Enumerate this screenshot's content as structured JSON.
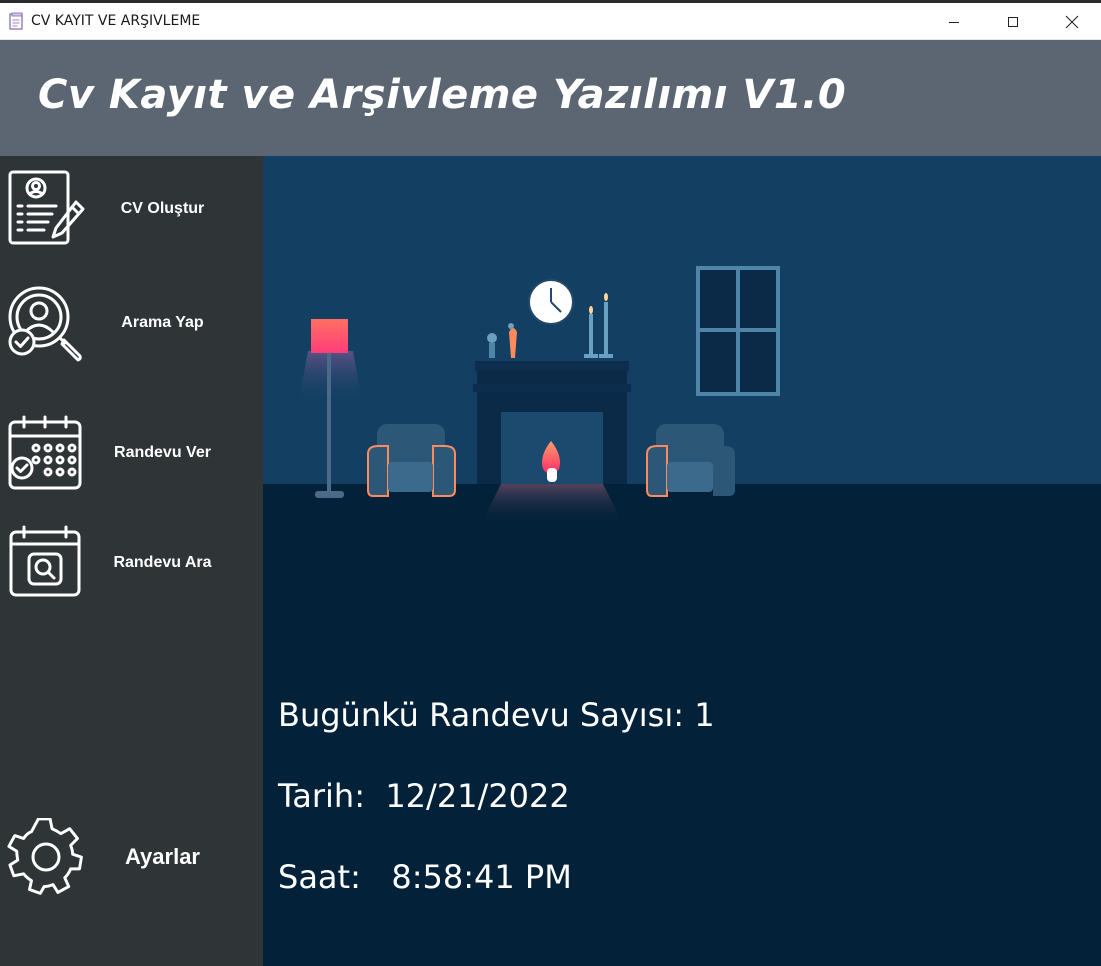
{
  "window": {
    "title": "CV KAYIT VE ARŞIVLEME",
    "controls": [
      "minimize-icon",
      "maximize-icon",
      "close-icon"
    ]
  },
  "header": {
    "title": "Cv Kayıt ve Arşivleme Yazılımı V1.0"
  },
  "sidebar": {
    "items": [
      {
        "label": "CV Oluştur",
        "icon": "cv-create-icon"
      },
      {
        "label": "Arama Yap",
        "icon": "search-person-icon"
      },
      {
        "label": "Randevu Ver",
        "icon": "calendar-check-icon"
      },
      {
        "label": "Randevu Ara",
        "icon": "calendar-search-icon"
      }
    ],
    "settings": {
      "label": "Ayarlar",
      "icon": "gear-icon"
    }
  },
  "main": {
    "appointments_today": "Bugünkü Randevu Sayısı: 1",
    "date_line": "Tarih:  12/21/2022",
    "time_line": "Saat:   8:58:41 PM"
  },
  "colors": {
    "header_bg": "#5c6673",
    "sidebar_bg": "#2f3437",
    "main_bg": "#03223a",
    "wall": "#123f62",
    "accent_flame": "#ff3d6e",
    "lamp": "#ff6b6b"
  }
}
